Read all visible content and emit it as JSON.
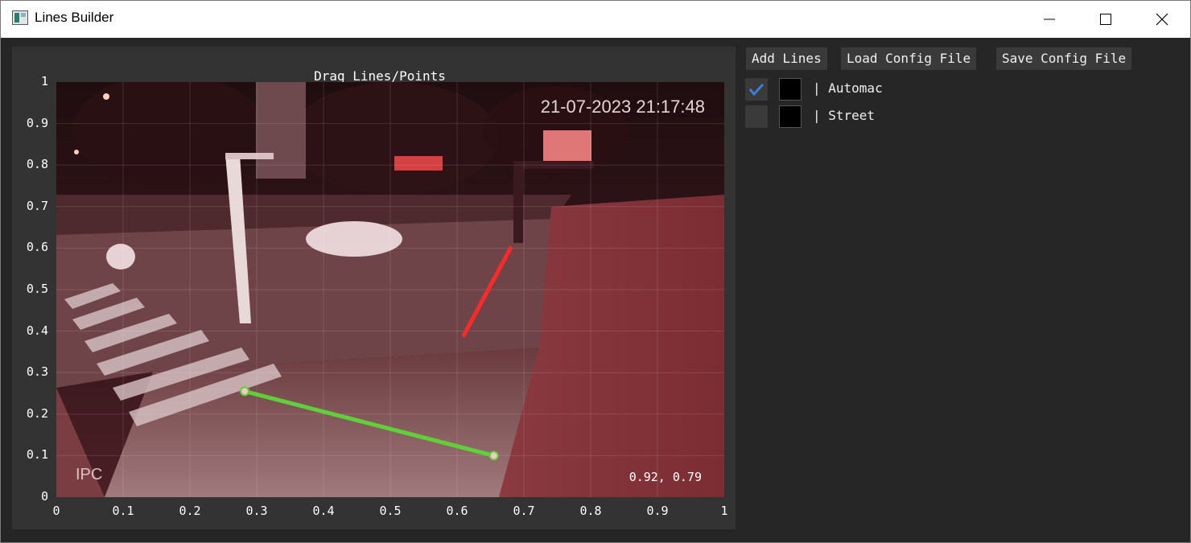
{
  "window": {
    "title": "Lines Builder",
    "controls": [
      "minimize",
      "maximize",
      "close"
    ]
  },
  "plot": {
    "title": "Drag Lines/Points",
    "x_ticks": [
      "0",
      "0.1",
      "0.2",
      "0.3",
      "0.4",
      "0.5",
      "0.6",
      "0.7",
      "0.8",
      "0.9",
      "1"
    ],
    "y_ticks": [
      "0",
      "0.1",
      "0.2",
      "0.3",
      "0.4",
      "0.5",
      "0.6",
      "0.7",
      "0.8",
      "0.9",
      "1"
    ],
    "coordinate_readout": "0.92, 0.79",
    "camera_overlay": {
      "timestamp": "21-07-2023 21:17:48",
      "brand": "IPC"
    },
    "lines": [
      {
        "color": "#ff2a2a",
        "points": [
          [
            0.61,
            0.39
          ],
          [
            0.68,
            0.6
          ]
        ],
        "handles": false
      },
      {
        "color": "#5fd03a",
        "points": [
          [
            0.282,
            0.255
          ],
          [
            0.655,
            0.1
          ]
        ],
        "handles": true
      }
    ]
  },
  "toolbar": {
    "add_lines": "Add Lines",
    "load_config": "Load Config File",
    "save_config": "Save Config File"
  },
  "line_list": [
    {
      "name": "Automac",
      "checked": true,
      "prefix": "| "
    },
    {
      "name": "Street",
      "checked": false,
      "prefix": "| "
    }
  ],
  "colors": {
    "background": "#262626",
    "panel": "#333333",
    "button": "#3a3a3a",
    "check": "#3b7fd4"
  }
}
